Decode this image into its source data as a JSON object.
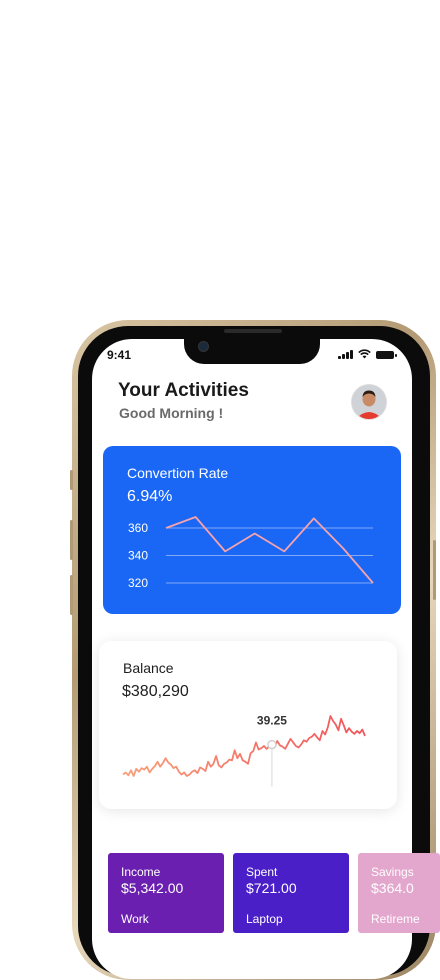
{
  "status_bar": {
    "time": "9:41"
  },
  "header": {
    "title": "Your Activities",
    "subtitle": "Good Morning !",
    "avatar_icon": "user-avatar"
  },
  "conversion_card": {
    "title": "Convertion Rate",
    "value": "6.94%",
    "color": "#1a66f5",
    "chart_data": {
      "type": "line",
      "yticks": [
        "360",
        "340",
        "320"
      ],
      "ylim": [
        320,
        360
      ],
      "values": [
        360,
        368,
        343,
        356,
        343,
        367,
        345,
        320
      ]
    }
  },
  "balance_card": {
    "title": "Balance",
    "value": "$380,290",
    "tooltip": "39.25",
    "chart_data": {
      "type": "line",
      "values": [
        10,
        13,
        9,
        16,
        8,
        18,
        14,
        19,
        17,
        21,
        13,
        18,
        22,
        28,
        21,
        26,
        33,
        27,
        24,
        19,
        21,
        14,
        10,
        13,
        8,
        10,
        14,
        16,
        12,
        20,
        18,
        15,
        28,
        21,
        25,
        36,
        23,
        20,
        25,
        27,
        31,
        30,
        44,
        33,
        39,
        30,
        28,
        25,
        40,
        43,
        55,
        45,
        47,
        50,
        46,
        49,
        52,
        48,
        57,
        51,
        49,
        46,
        53,
        60,
        55,
        50,
        48,
        52,
        58,
        56,
        61,
        63,
        67,
        62,
        58,
        71,
        66,
        76,
        92,
        85,
        80,
        72,
        88,
        79,
        69,
        75,
        70,
        67,
        71,
        68,
        73,
        64
      ],
      "highlight_value": 39.25
    }
  },
  "tiles": [
    {
      "label": "Income",
      "amount": "$5,342.00",
      "category": "Work",
      "color": "#6a1fb0"
    },
    {
      "label": "Spent",
      "amount": "$721.00",
      "category": "Laptop",
      "color": "#4a1fc8"
    },
    {
      "label": "Savings",
      "amount": "$364.0",
      "category": "Retireme",
      "color": "#e3a6cc"
    }
  ]
}
